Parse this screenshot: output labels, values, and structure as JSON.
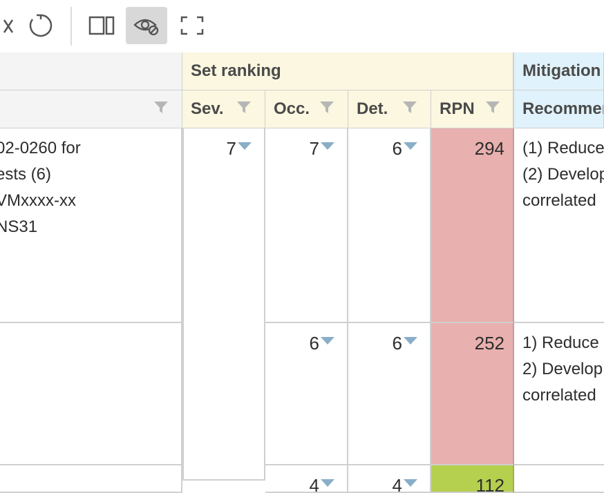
{
  "toolbar": {
    "buttons": [
      {
        "name": "clear-filter-icon",
        "active": false
      },
      {
        "name": "refresh-icon",
        "active": false
      },
      {
        "name": "split-view-icon",
        "active": false
      },
      {
        "name": "hide-columns-icon",
        "active": true
      },
      {
        "name": "fullscreen-icon",
        "active": false
      }
    ]
  },
  "headers": {
    "group_set_ranking": "Set ranking",
    "group_mitigation": "Mitigation",
    "sev": "Sev.",
    "occ": "Occ.",
    "det": "Det.",
    "rpn": "RPN",
    "recommended": "Recommended"
  },
  "rows": [
    {
      "desc": [
        "02-0260 for",
        "ests (6)",
        "VMxxxx-xx",
        "NS31"
      ],
      "sev": "7",
      "occ": "7",
      "det": "6",
      "rpn": "294",
      "rpn_color": "#e8b0ae",
      "mitigation": [
        "(1) Reduce",
        "(2) Develop",
        "correlated"
      ]
    },
    {
      "desc": [],
      "sev": "",
      "occ": "6",
      "det": "6",
      "rpn": "252",
      "rpn_color": "#e8b0ae",
      "mitigation": [
        "1) Reduce",
        "2) Develop",
        "correlated"
      ]
    },
    {
      "desc": [],
      "sev": "",
      "occ": "4",
      "det": "4",
      "rpn": "112",
      "rpn_color": "#b5cf4e",
      "mitigation": []
    }
  ],
  "colors": {
    "header_yellow": "#fbf7e0",
    "header_blue": "#e0f2fb",
    "rpn_high": "#e8b0ae",
    "rpn_low": "#b5cf4e",
    "dropdown_arrow": "#8aaec8"
  }
}
